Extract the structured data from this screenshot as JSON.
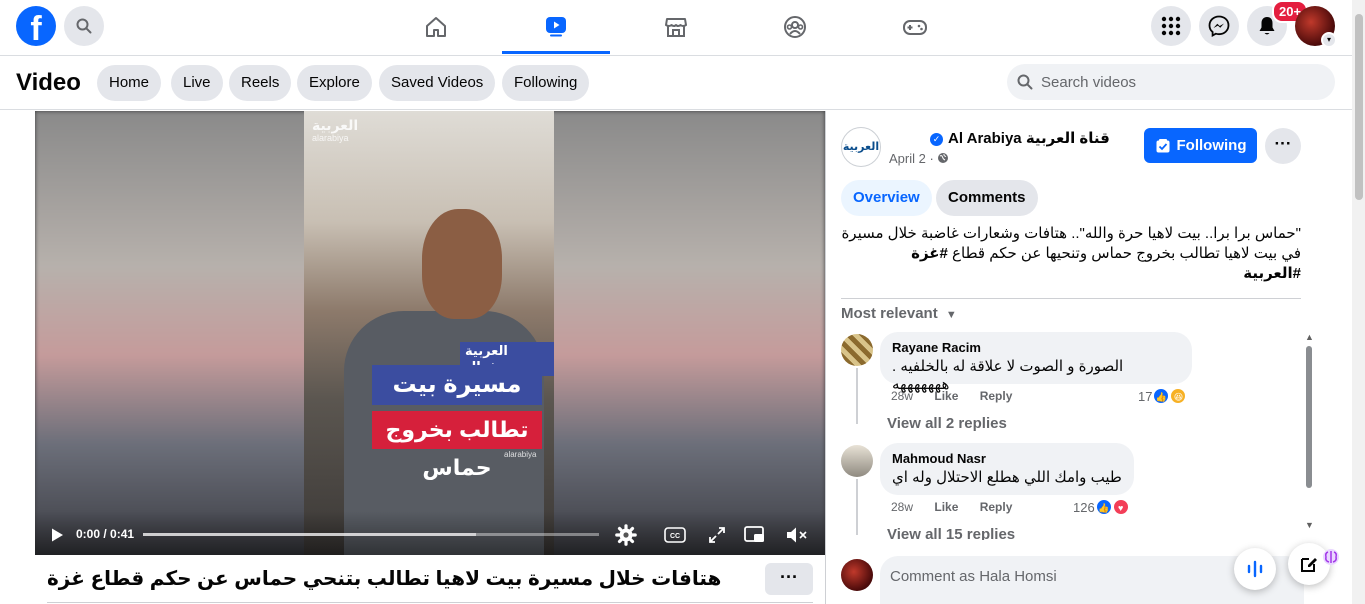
{
  "topnav": {
    "logo": "f",
    "badge": "20+"
  },
  "subheader": {
    "title": "Video",
    "chips": [
      "Home",
      "Live",
      "Reels",
      "Explore",
      "Saved Videos",
      "Following"
    ],
    "search_placeholder": "Search videos"
  },
  "video": {
    "watermark": "العربية",
    "watermark_sub": "alarabiya",
    "caption_tag": "العربية سوشيال",
    "caption_line1": "مسيرة بيت لاهيا",
    "caption_line2": "تطالب بخروج حماس",
    "caption_foot": "alarabiya",
    "time": "0:00 / 0:41",
    "progress": 0.73,
    "title": "هتافات خلال مسيرة بيت لاهيا تطالب بتنحي حماس عن حكم قطاع غزة"
  },
  "post": {
    "page_name": "Al Arabiya قناة العربية",
    "avatar_text": "العربية",
    "date": "April 2 ·",
    "follow_label": "Following",
    "tabs": [
      "Overview",
      "Comments"
    ],
    "desc_line1": "\"حماس برا برا.. بيت لاهيا حرة والله\".. هتافات وشعارات غاضبة خلال مسيرة",
    "desc_line2": "في بيت لاهيا تطالب بخروج حماس وتنحيها عن حكم قطاع",
    "desc_hash1": "#غزة",
    "desc_hash2": "#العربية",
    "sort_label": "Most relevant"
  },
  "comments": [
    {
      "author": "Rayane Racim",
      "text": "الصورة و الصوت لا علاقة له بالخلفيه . هههههههه",
      "time": "28w",
      "like": "Like",
      "reply": "Reply",
      "reactions": "17",
      "view_replies": "View all 2 replies"
    },
    {
      "author": "Mahmoud Nasr",
      "text": "طيب وامك اللي هطلع الاحتلال وله اي",
      "time": "28w",
      "like": "Like",
      "reply": "Reply",
      "reactions": "126",
      "view_replies": "View all 15 replies"
    }
  ],
  "comment_input": {
    "placeholder": "Comment as Hala Homsi"
  },
  "colors": {
    "brand": "#0866ff",
    "badge": "#e41e3f"
  }
}
